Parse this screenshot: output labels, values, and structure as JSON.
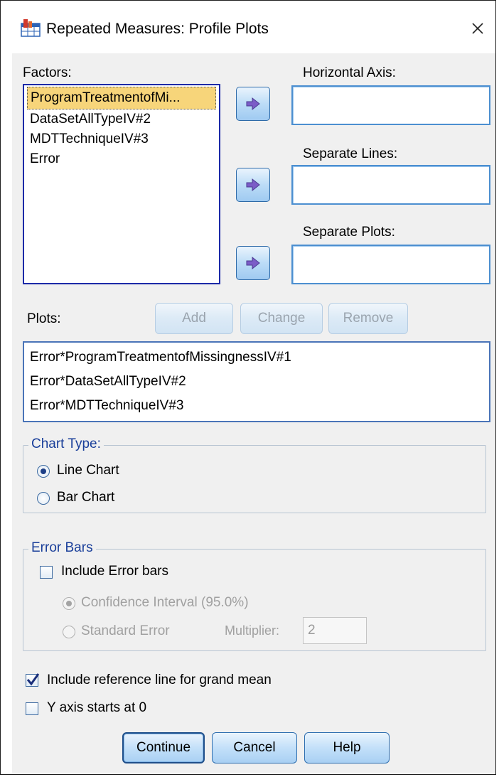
{
  "window": {
    "title": "Repeated Measures: Profile Plots",
    "icon": "spss-chart-app-icon",
    "close_glyph": "✕"
  },
  "factors": {
    "label": "Factors:",
    "items": [
      {
        "label": "ProgramTreatmentofMi...",
        "selected": true
      },
      {
        "label": "DataSetAllTypeIV#2",
        "selected": false
      },
      {
        "label": "MDTTechniqueIV#3",
        "selected": false
      },
      {
        "label": "Error",
        "selected": false
      }
    ]
  },
  "horizontal_axis": {
    "label": "Horizontal Axis:",
    "value": ""
  },
  "separate_lines": {
    "label": "Separate Lines:",
    "value": ""
  },
  "separate_plots": {
    "label": "Separate Plots:",
    "value": ""
  },
  "plots": {
    "label": "Plots:",
    "add_label": "Add",
    "change_label": "Change",
    "remove_label": "Remove",
    "items": [
      "Error*ProgramTreatmentofMissingnessIV#1",
      "Error*DataSetAllTypeIV#2",
      "Error*MDTTechniqueIV#3"
    ]
  },
  "chart_type": {
    "legend": "Chart Type:",
    "line_label": "Line Chart",
    "bar_label": "Bar Chart",
    "selected": "Line Chart"
  },
  "error_bars": {
    "legend": "Error Bars",
    "include_label": "Include Error bars",
    "include_checked": false,
    "ci_label": "Confidence Interval (95.0%)",
    "se_label": "Standard Error",
    "multiplier_label": "Multiplier:",
    "multiplier_value": "2"
  },
  "options": {
    "grand_mean_label": "Include reference line for grand mean",
    "grand_mean_checked": true,
    "y_zero_label": "Y axis starts at 0",
    "y_zero_checked": false
  },
  "buttons": {
    "continue": "Continue",
    "cancel": "Cancel",
    "help": "Help"
  },
  "colors": {
    "group_legend": "#1a3f9a",
    "selection": "#f7d57a",
    "button_border": "#2f6fb0"
  }
}
